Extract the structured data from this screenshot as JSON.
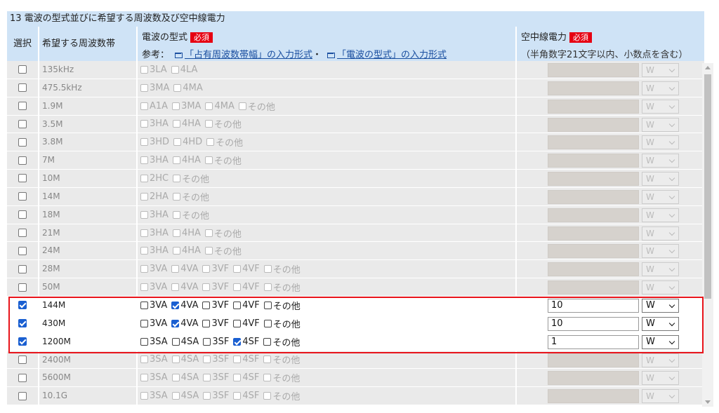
{
  "section_title": "13 電波の型式並びに希望する周波数及び空中線電力",
  "headers": {
    "select": "選択",
    "band": "希望する周波数帯",
    "type_title": "電波の型式",
    "required": "必須",
    "ref_prefix": "参考：",
    "ref_link1": "「占有周波数帯幅」の入力形式",
    "ref_sep": "・",
    "ref_link2": "「電波の型式」の入力形式",
    "power_title": "空中線電力",
    "power_hint": "（半角数字21文字以内、小数点を含む）"
  },
  "rows": [
    {
      "band": "135kHz",
      "selected": false,
      "types": [
        {
          "label": "3LA",
          "checked": false
        },
        {
          "label": "4LA",
          "checked": false
        }
      ],
      "power": "",
      "unit": "W"
    },
    {
      "band": "475.5kHz",
      "selected": false,
      "types": [
        {
          "label": "3MA",
          "checked": false
        },
        {
          "label": "4MA",
          "checked": false
        }
      ],
      "power": "",
      "unit": "W"
    },
    {
      "band": "1.9M",
      "selected": false,
      "types": [
        {
          "label": "A1A",
          "checked": false
        },
        {
          "label": "3MA",
          "checked": false
        },
        {
          "label": "4MA",
          "checked": false
        },
        {
          "label": "その他",
          "checked": false
        }
      ],
      "power": "",
      "unit": "W"
    },
    {
      "band": "3.5M",
      "selected": false,
      "types": [
        {
          "label": "3HA",
          "checked": false
        },
        {
          "label": "4HA",
          "checked": false
        },
        {
          "label": "その他",
          "checked": false
        }
      ],
      "power": "",
      "unit": "W"
    },
    {
      "band": "3.8M",
      "selected": false,
      "types": [
        {
          "label": "3HD",
          "checked": false
        },
        {
          "label": "4HD",
          "checked": false
        },
        {
          "label": "その他",
          "checked": false
        }
      ],
      "power": "",
      "unit": "W"
    },
    {
      "band": "7M",
      "selected": false,
      "types": [
        {
          "label": "3HA",
          "checked": false
        },
        {
          "label": "4HA",
          "checked": false
        },
        {
          "label": "その他",
          "checked": false
        }
      ],
      "power": "",
      "unit": "W"
    },
    {
      "band": "10M",
      "selected": false,
      "types": [
        {
          "label": "2HC",
          "checked": false
        },
        {
          "label": "その他",
          "checked": false
        }
      ],
      "power": "",
      "unit": "W"
    },
    {
      "band": "14M",
      "selected": false,
      "types": [
        {
          "label": "2HA",
          "checked": false
        },
        {
          "label": "その他",
          "checked": false
        }
      ],
      "power": "",
      "unit": "W"
    },
    {
      "band": "18M",
      "selected": false,
      "types": [
        {
          "label": "3HA",
          "checked": false
        },
        {
          "label": "その他",
          "checked": false
        }
      ],
      "power": "",
      "unit": "W"
    },
    {
      "band": "21M",
      "selected": false,
      "types": [
        {
          "label": "3HA",
          "checked": false
        },
        {
          "label": "4HA",
          "checked": false
        },
        {
          "label": "その他",
          "checked": false
        }
      ],
      "power": "",
      "unit": "W"
    },
    {
      "band": "24M",
      "selected": false,
      "types": [
        {
          "label": "3HA",
          "checked": false
        },
        {
          "label": "4HA",
          "checked": false
        },
        {
          "label": "その他",
          "checked": false
        }
      ],
      "power": "",
      "unit": "W"
    },
    {
      "band": "28M",
      "selected": false,
      "types": [
        {
          "label": "3VA",
          "checked": false
        },
        {
          "label": "4VA",
          "checked": false
        },
        {
          "label": "3VF",
          "checked": false
        },
        {
          "label": "4VF",
          "checked": false
        },
        {
          "label": "その他",
          "checked": false
        }
      ],
      "power": "",
      "unit": "W"
    },
    {
      "band": "50M",
      "selected": false,
      "types": [
        {
          "label": "3VA",
          "checked": false
        },
        {
          "label": "4VA",
          "checked": false
        },
        {
          "label": "3VF",
          "checked": false
        },
        {
          "label": "4VF",
          "checked": false
        },
        {
          "label": "その他",
          "checked": false
        }
      ],
      "power": "",
      "unit": "W"
    },
    {
      "band": "144M",
      "selected": true,
      "types": [
        {
          "label": "3VA",
          "checked": false
        },
        {
          "label": "4VA",
          "checked": true
        },
        {
          "label": "3VF",
          "checked": false
        },
        {
          "label": "4VF",
          "checked": false
        },
        {
          "label": "その他",
          "checked": false
        }
      ],
      "power": "10",
      "unit": "W"
    },
    {
      "band": "430M",
      "selected": true,
      "types": [
        {
          "label": "3VA",
          "checked": false
        },
        {
          "label": "4VA",
          "checked": true
        },
        {
          "label": "3VF",
          "checked": false
        },
        {
          "label": "4VF",
          "checked": false
        },
        {
          "label": "その他",
          "checked": false
        }
      ],
      "power": "10",
      "unit": "W"
    },
    {
      "band": "1200M",
      "selected": true,
      "types": [
        {
          "label": "3SA",
          "checked": false
        },
        {
          "label": "4SA",
          "checked": false
        },
        {
          "label": "3SF",
          "checked": false
        },
        {
          "label": "4SF",
          "checked": true
        },
        {
          "label": "その他",
          "checked": false
        }
      ],
      "power": "1",
      "unit": "W"
    },
    {
      "band": "2400M",
      "selected": false,
      "types": [
        {
          "label": "3SA",
          "checked": false
        },
        {
          "label": "4SA",
          "checked": false
        },
        {
          "label": "3SF",
          "checked": false
        },
        {
          "label": "4SF",
          "checked": false
        },
        {
          "label": "その他",
          "checked": false
        }
      ],
      "power": "",
      "unit": "W"
    },
    {
      "band": "5600M",
      "selected": false,
      "types": [
        {
          "label": "3SA",
          "checked": false
        },
        {
          "label": "4SA",
          "checked": false
        },
        {
          "label": "3SF",
          "checked": false
        },
        {
          "label": "4SF",
          "checked": false
        },
        {
          "label": "その他",
          "checked": false
        }
      ],
      "power": "",
      "unit": "W"
    },
    {
      "band": "10.1G",
      "selected": false,
      "types": [
        {
          "label": "3SA",
          "checked": false
        },
        {
          "label": "4SA",
          "checked": false
        },
        {
          "label": "3SF",
          "checked": false
        },
        {
          "label": "4SF",
          "checked": false
        },
        {
          "label": "その他",
          "checked": false
        }
      ],
      "power": "",
      "unit": "W"
    }
  ],
  "colors": {
    "header_bg": "#cfe3f6",
    "required_bg": "#e60012",
    "check_blue": "#1a5fd1",
    "highlight": "#e8141b",
    "disabled_bg": "#eaeaea"
  }
}
